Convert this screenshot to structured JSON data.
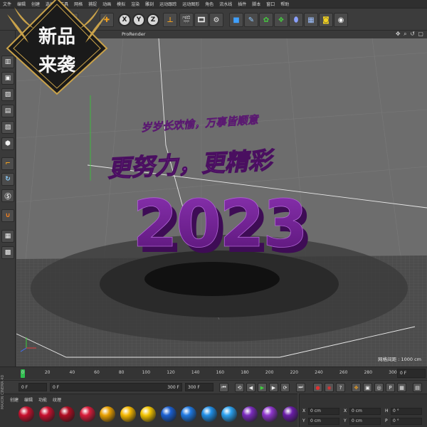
{
  "menubar": {
    "items": [
      "文件",
      "编辑",
      "创建",
      "选择",
      "工具",
      "网格",
      "捕捉",
      "动画",
      "模拟",
      "渲染",
      "雕刻",
      "运动跟踪",
      "运动图形",
      "角色",
      "流水线",
      "插件",
      "脚本",
      "窗口",
      "帮助"
    ]
  },
  "toolbar": {
    "x_label": "X",
    "y_label": "Y",
    "z_label": "Z"
  },
  "badge": {
    "line1": "新品",
    "line2": "来袭"
  },
  "viewport": {
    "title": "ProRender",
    "nav_icons": "✥ ⌕ ↺ ▢",
    "grid_label": "网格间距 : 1000 cm"
  },
  "scene": {
    "small_text": "岁岁长欢愉，万事皆顺意",
    "big_text": "更努力，更精彩",
    "year": "2023"
  },
  "timeline": {
    "ticks": [
      "0",
      "20",
      "40",
      "60",
      "80",
      "100",
      "120",
      "140",
      "160",
      "180",
      "200",
      "220",
      "240",
      "260",
      "280",
      "300"
    ],
    "frame_box": "0 F"
  },
  "transport": {
    "start_field": "0 F",
    "range_start": "0 F",
    "range_end": "300 F",
    "end_field": "300 F"
  },
  "materials": {
    "menu": [
      "创建",
      "编辑",
      "功能",
      "纹理"
    ],
    "colors": [
      "#c8102e",
      "#c8102e",
      "#b00c22",
      "#d81b3a",
      "#e8a000",
      "#f5b800",
      "#f2c400",
      "#1a5fd0",
      "#1e78e0",
      "#1f8ee6",
      "#2aa0ee",
      "#7a2bbd",
      "#8e36cc",
      "#6a1da8"
    ],
    "side_label": "MAXON CINEMA 4D"
  },
  "attributes": {
    "rows": [
      {
        "a_label": "X",
        "a_value": "0 cm",
        "b_label": "X",
        "b_value": "0 cm",
        "c_label": "H",
        "c_value": "0 °"
      },
      {
        "a_label": "Y",
        "a_value": "0 cm",
        "b_label": "Y",
        "b_value": "0 cm",
        "c_label": "P",
        "c_value": "0 °"
      }
    ]
  },
  "colors": {
    "accent_green": "#2fbf4f",
    "year_purple": "#6a1f8a",
    "text_purple": "#8a3aa6",
    "badge_gold": "#c9a24a"
  }
}
